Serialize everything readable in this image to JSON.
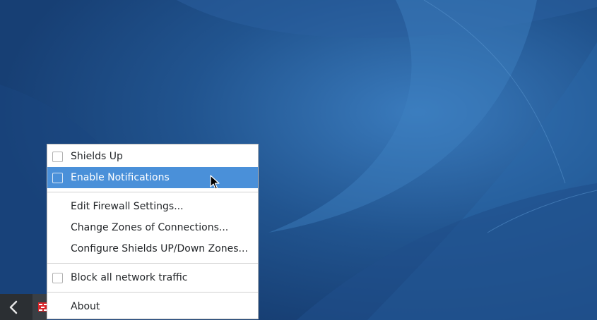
{
  "desktop": {
    "background_color": "#1d4a86",
    "accent_color": "#2f6fb0"
  },
  "panel": {
    "back_icon": "chevron-left-icon",
    "tray_icon": "firewall-icon"
  },
  "menu": {
    "highlight_color": "#4a90d9",
    "items": [
      {
        "label": "Shields Up",
        "checkbox": true,
        "checked": false
      },
      {
        "label": "Enable Notifications",
        "checkbox": true,
        "checked": false,
        "highlighted": true
      },
      {
        "label": "Edit Firewall Settings...",
        "checkbox": false
      },
      {
        "label": "Change Zones of Connections...",
        "checkbox": false
      },
      {
        "label": "Configure Shields UP/Down Zones...",
        "checkbox": false
      },
      {
        "label": "Block all network traffic",
        "checkbox": true,
        "checked": false
      },
      {
        "label": "About",
        "checkbox": false
      }
    ]
  }
}
